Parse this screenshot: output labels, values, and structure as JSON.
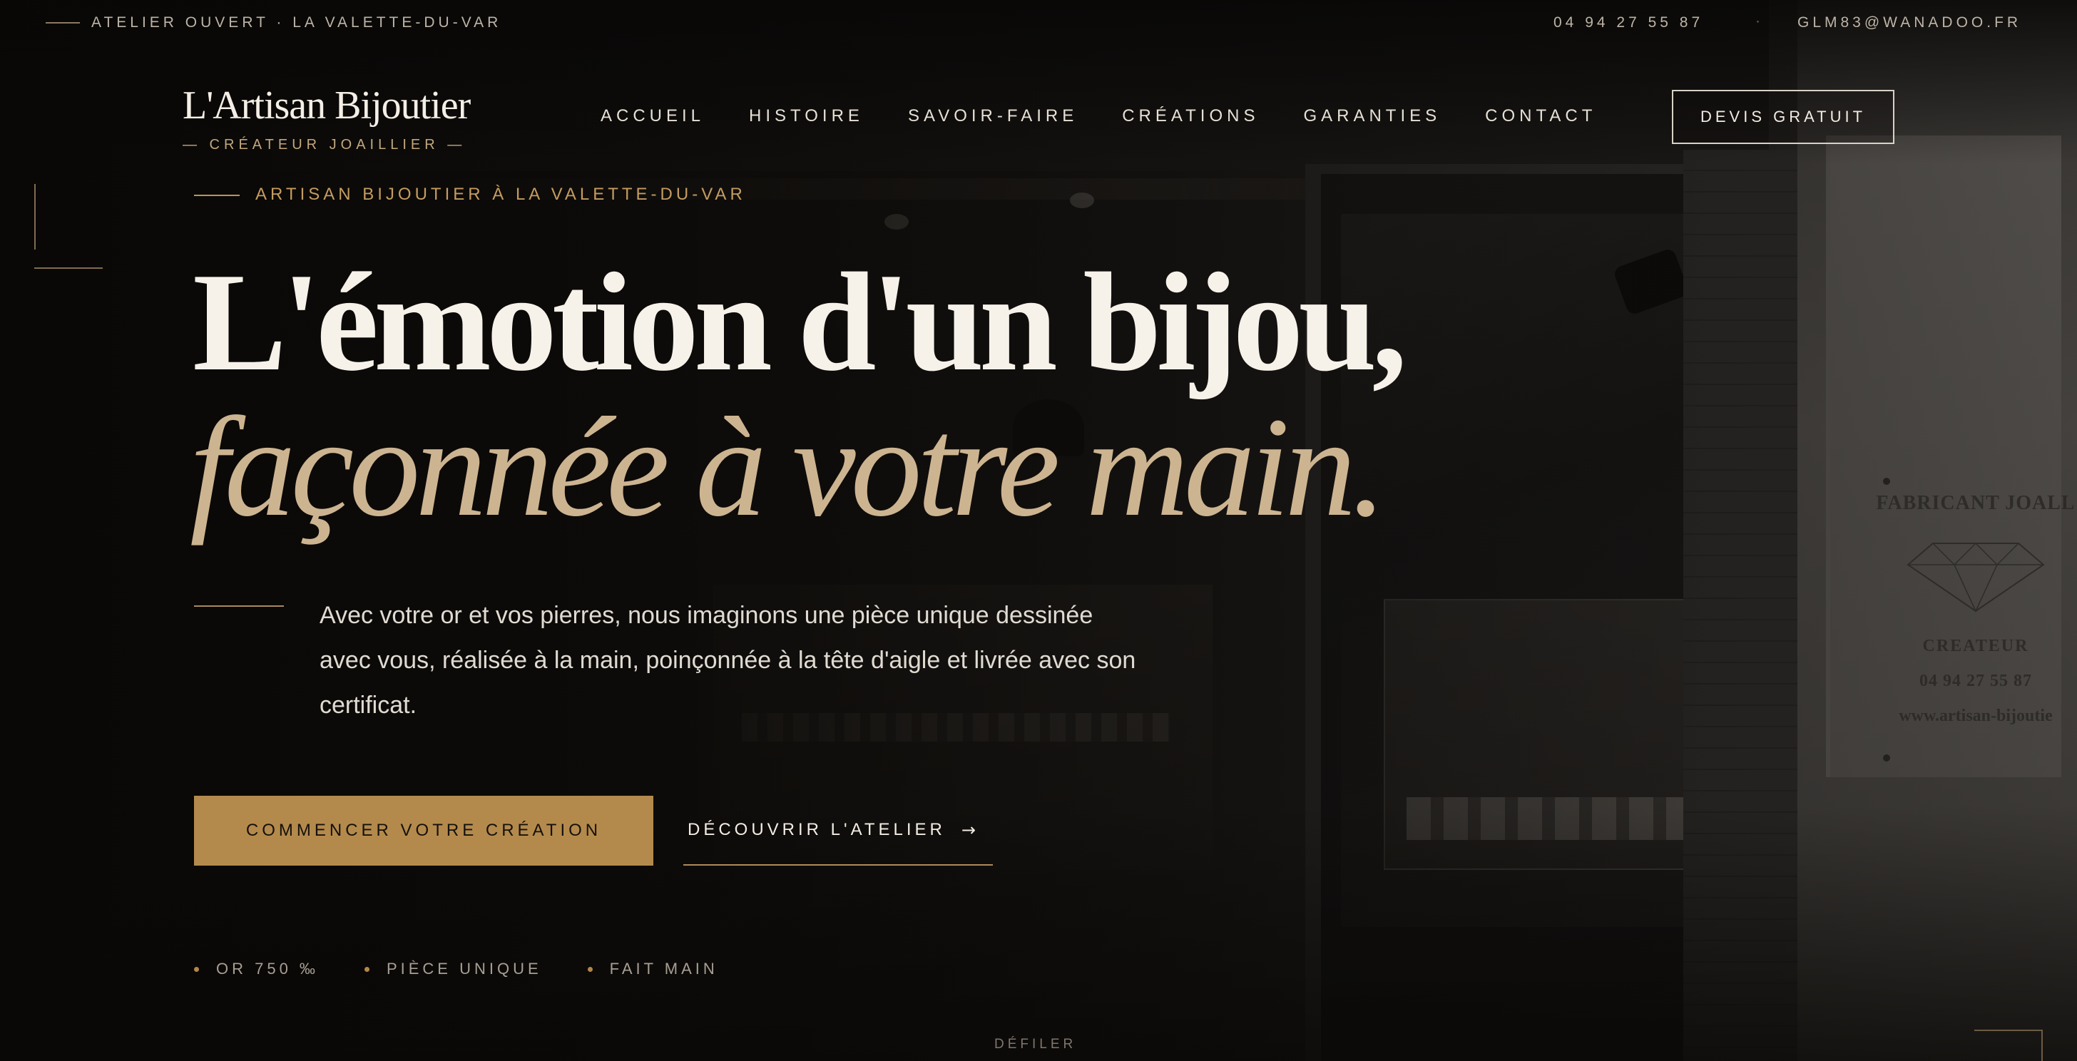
{
  "topbar": {
    "status": "ATELIER OUVERT · LA VALETTE-DU-VAR",
    "phone": "04 94 27 55 87",
    "separator": "·",
    "email": "GLM83@WANADOO.FR"
  },
  "brand": {
    "name": "L'Artisan Bijoutier",
    "tagline": "— CRÉATEUR JOAILLIER —"
  },
  "nav": {
    "items": [
      {
        "label": "ACCUEIL"
      },
      {
        "label": "HISTOIRE"
      },
      {
        "label": "SAVOIR-FAIRE"
      },
      {
        "label": "CRÉATIONS"
      },
      {
        "label": "GARANTIES"
      },
      {
        "label": "CONTACT"
      }
    ],
    "cta": "DEVIS GRATUIT"
  },
  "hero": {
    "eyebrow": "ARTISAN BIJOUTIER À LA VALETTE-DU-VAR",
    "title_line1": "L'émotion d'un bijou,",
    "title_line2": "façonnée à votre main.",
    "description": "Avec votre or et vos pierres, nous imaginons une pièce unique dessinée avec vous, réalisée à la main, poinçonnée à la tête d'aigle et livrée avec son certificat.",
    "primary_button": "COMMENCER VOTRE CRÉATION",
    "secondary_button": "DÉCOUVRIR L'ATELIER",
    "secondary_icon": "arrow-right-icon",
    "features": [
      {
        "label": "OR 750 ‰"
      },
      {
        "label": "PIÈCE UNIQUE"
      },
      {
        "label": "FAIT MAIN"
      }
    ],
    "scroll_label": "DÉFILER"
  },
  "background_sign": {
    "title": "FABRICANT JOALL",
    "subtitle": "CREATEUR",
    "phone": "04 94 27 55 87",
    "website": "www.artisan-bijoutie"
  },
  "colors": {
    "accent_gold": "#b48a4c",
    "title_italic": "#cdb491",
    "background": "#0d0b09"
  }
}
